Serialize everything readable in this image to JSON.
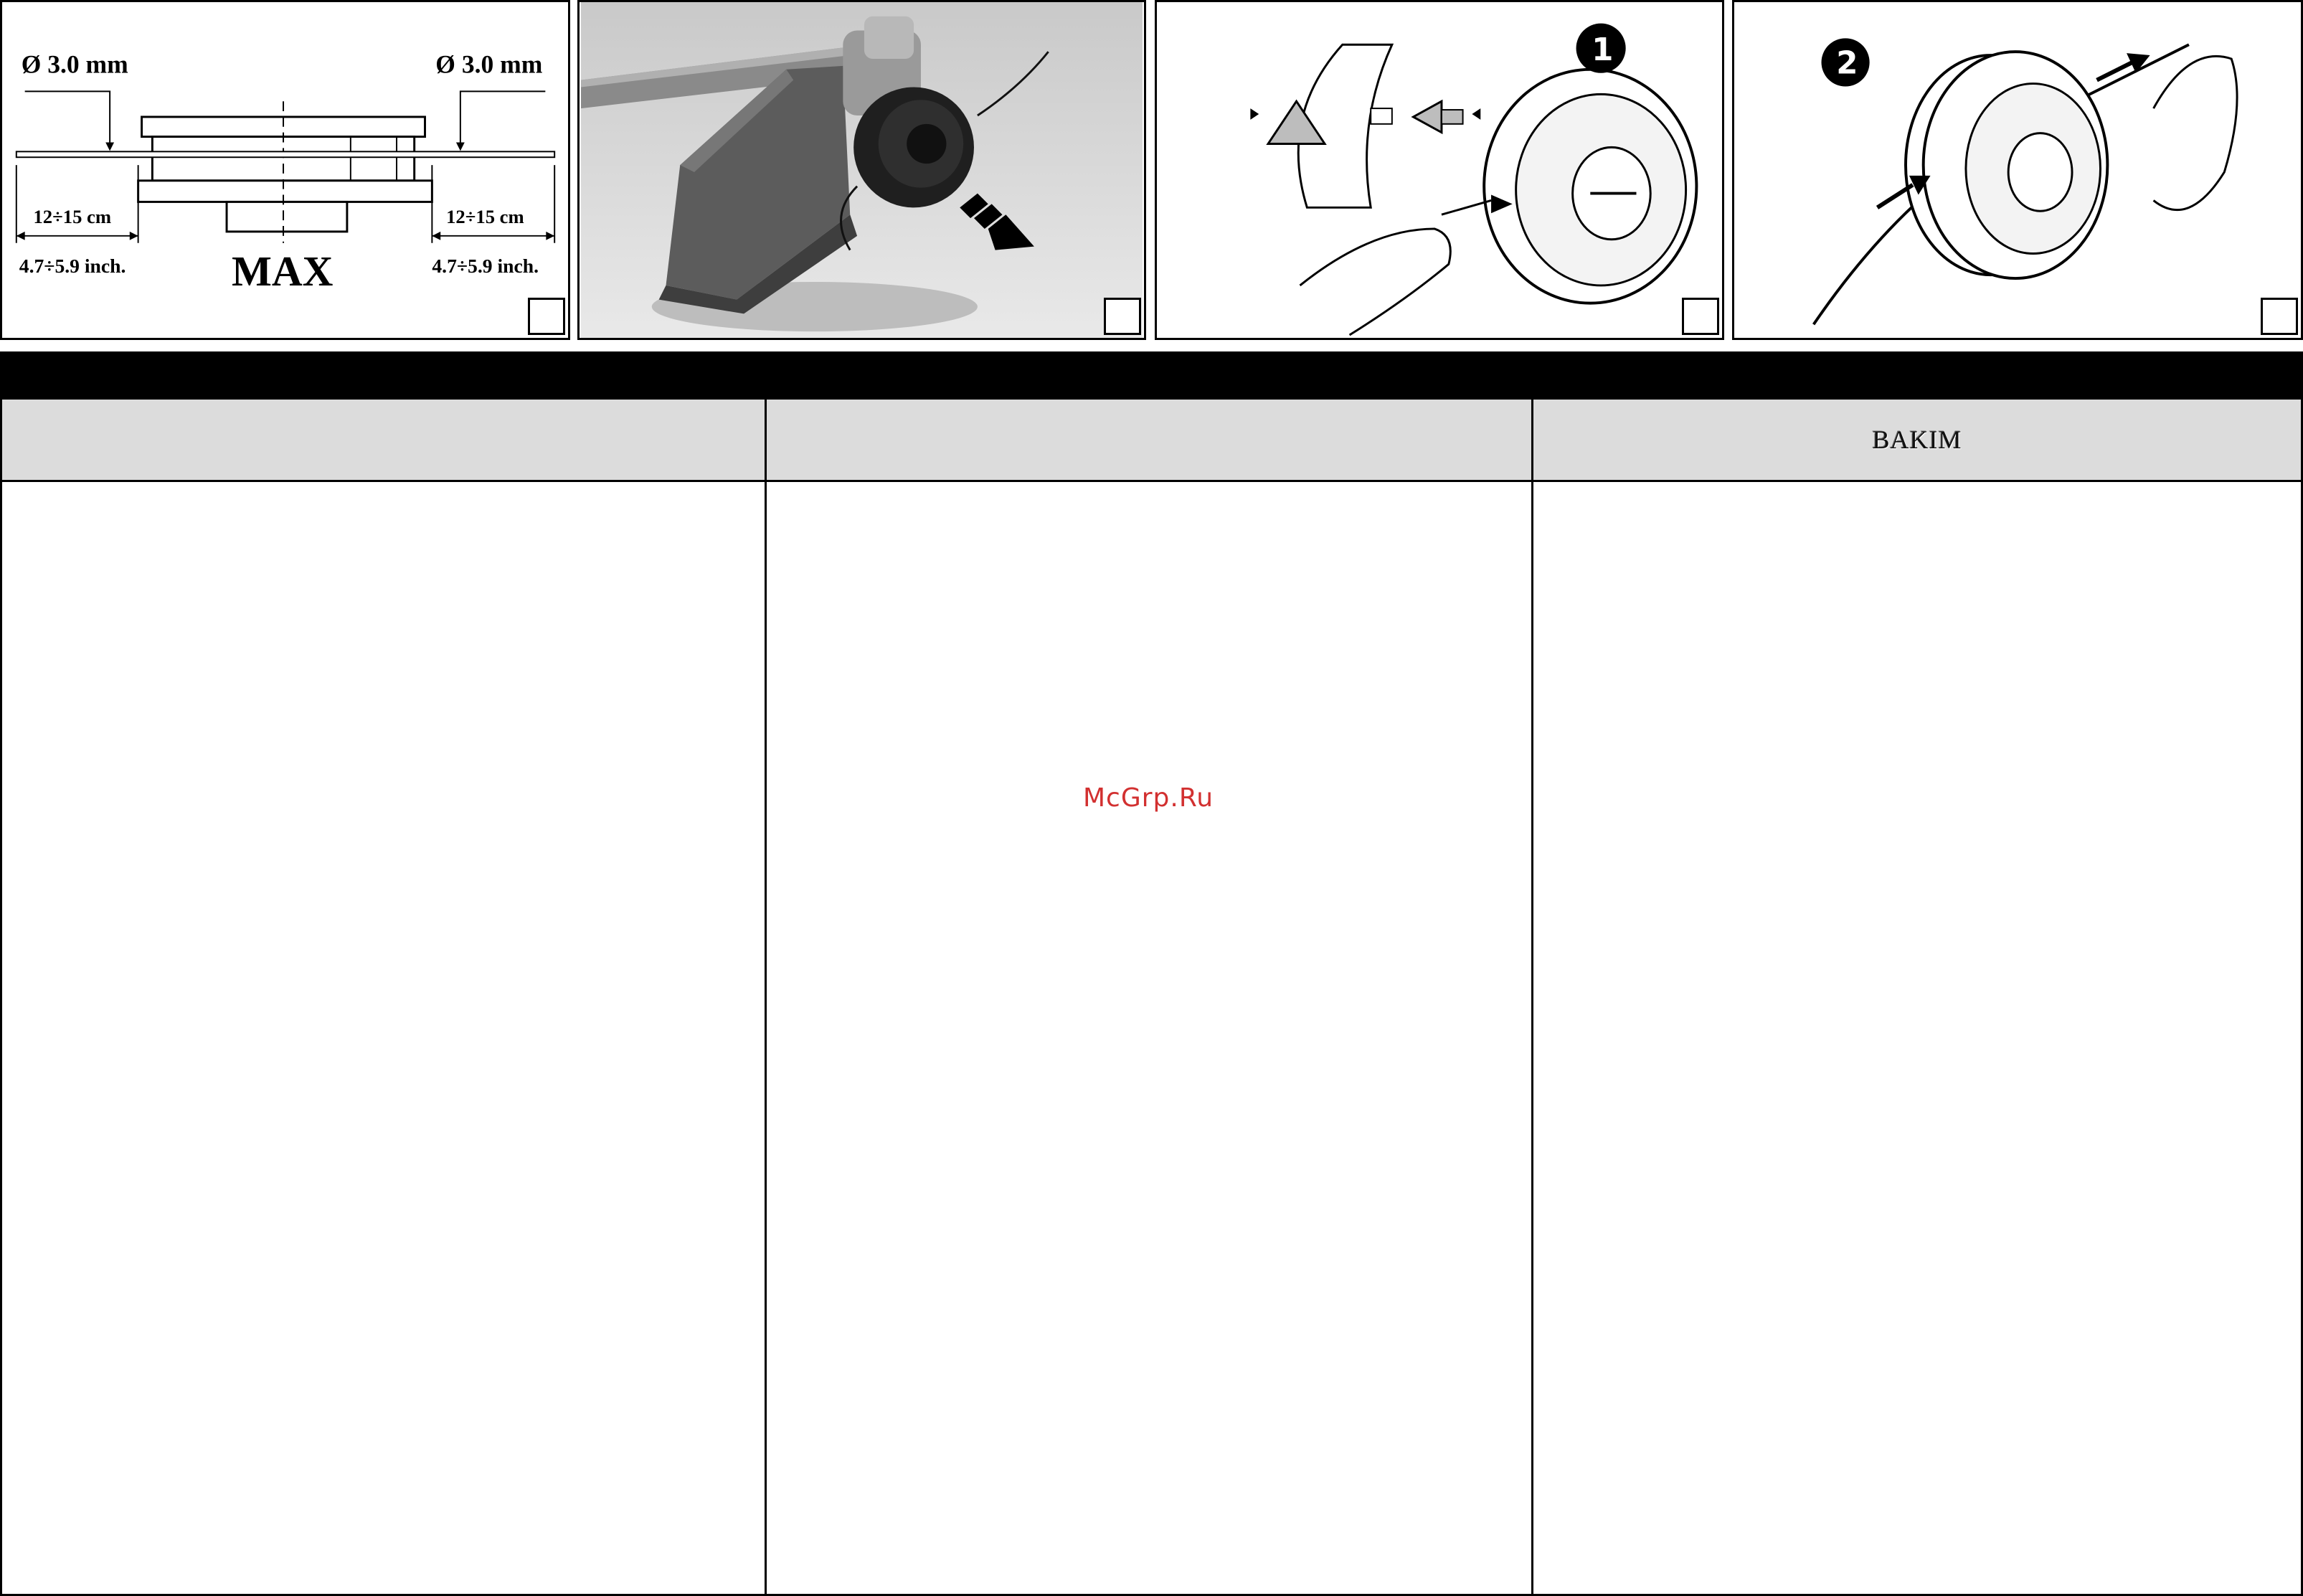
{
  "figures": {
    "fig1": {
      "left_diameter": "Ø 3.0 mm",
      "right_diameter": "Ø 3.0 mm",
      "left_length_cm": "12÷15 cm",
      "right_length_cm": "12÷15 cm",
      "left_length_inch": "4.7÷5.9 inch.",
      "right_length_inch": "4.7÷5.9 inch.",
      "max_label": "MAX"
    },
    "fig3": {
      "step": "1"
    },
    "fig4": {
      "step": "2"
    }
  },
  "columns": [
    {
      "subtitle": ""
    },
    {
      "subtitle": ""
    },
    {
      "subtitle": "BAKIM"
    }
  ],
  "watermark": "McGrp.Ru"
}
